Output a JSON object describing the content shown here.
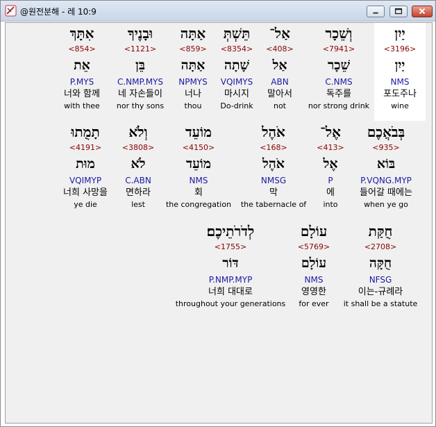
{
  "window": {
    "title": "@원전분해 - 레 10:9"
  },
  "words": [
    {
      "heb": "יַיִן",
      "num": "<3196>",
      "lemma": "יַיִן",
      "morph": "NMS",
      "kor": "포도주나",
      "eng": "wine"
    },
    {
      "heb": "וְשֵׁכָר",
      "num": "<7941>",
      "lemma": "שֵׁכָר",
      "morph": "C.NMS",
      "kor": "독주를",
      "eng": "nor strong drink"
    },
    {
      "heb": "אַל־",
      "num": "<408>",
      "lemma": "אַל",
      "morph": "ABN",
      "kor": "말아서",
      "eng": "not"
    },
    {
      "heb": "תֵּשְׁתְּ",
      "num": "<8354>",
      "lemma": "שָׁתָה",
      "morph": "VQIMYS",
      "kor": "마시지",
      "eng": "Do-drink"
    },
    {
      "heb": "אַתָּה",
      "num": "<859>",
      "lemma": "אַתָּה",
      "morph": "NPMYS",
      "kor": "너나",
      "eng": "thou"
    },
    {
      "heb": "וּבָנֶיךָ",
      "num": "<1121>",
      "lemma": "בֵּן",
      "morph": "C.NMP.MYS",
      "kor": "네 자손들이",
      "eng": "nor thy sons"
    },
    {
      "heb": "אִתָּךְ",
      "num": "<854>",
      "lemma": "אֵת",
      "morph": "P.MYS",
      "kor": "너와 함께",
      "eng": "with thee"
    },
    {
      "heb": "בְּבֹאֲכֶם",
      "num": "<935>",
      "lemma": "בּוֹא",
      "morph": "P.VQNG.MYP",
      "kor": "들어갈 때에는",
      "eng": "when ye go"
    },
    {
      "heb": "אֶל־",
      "num": "<413>",
      "lemma": "אֶל",
      "morph": "P",
      "kor": "에",
      "eng": "into"
    },
    {
      "heb": "אֹהֶל",
      "num": "<168>",
      "lemma": "אֹהֶל",
      "morph": "NMSG",
      "kor": "막",
      "eng": "the tabernacle of"
    },
    {
      "heb": "מוֹעֵד",
      "num": "<4150>",
      "lemma": "מוֹעֵד",
      "morph": "NMS",
      "kor": "회",
      "eng": "the congregation"
    },
    {
      "heb": "וְלֹא",
      "num": "<3808>",
      "lemma": "לֹא",
      "morph": "C.ABN",
      "kor": "면하라",
      "eng": "lest"
    },
    {
      "heb": "תָמֻתוּ",
      "num": "<4191>",
      "lemma": "מוּת",
      "morph": "VQIMYP",
      "kor": "너희 사망을",
      "eng": "ye die"
    },
    {
      "heb": "חֻקַּת",
      "num": "<2708>",
      "lemma": "חֻקָּה",
      "morph": "NFSG",
      "kor": "이는-규례라",
      "eng": "it shall be a statute"
    },
    {
      "heb": "עוֹלָם",
      "num": "<5769>",
      "lemma": "עוֹלָם",
      "morph": "NMS",
      "kor": "영영한",
      "eng": "for ever"
    },
    {
      "heb": "לְדֹרֹתֵיכֶם׃",
      "num": "<1755>",
      "lemma": "דּוֹר",
      "morph": "P.NMP.MYP",
      "kor": "너희 대대로",
      "eng": "throughout your generations"
    }
  ]
}
